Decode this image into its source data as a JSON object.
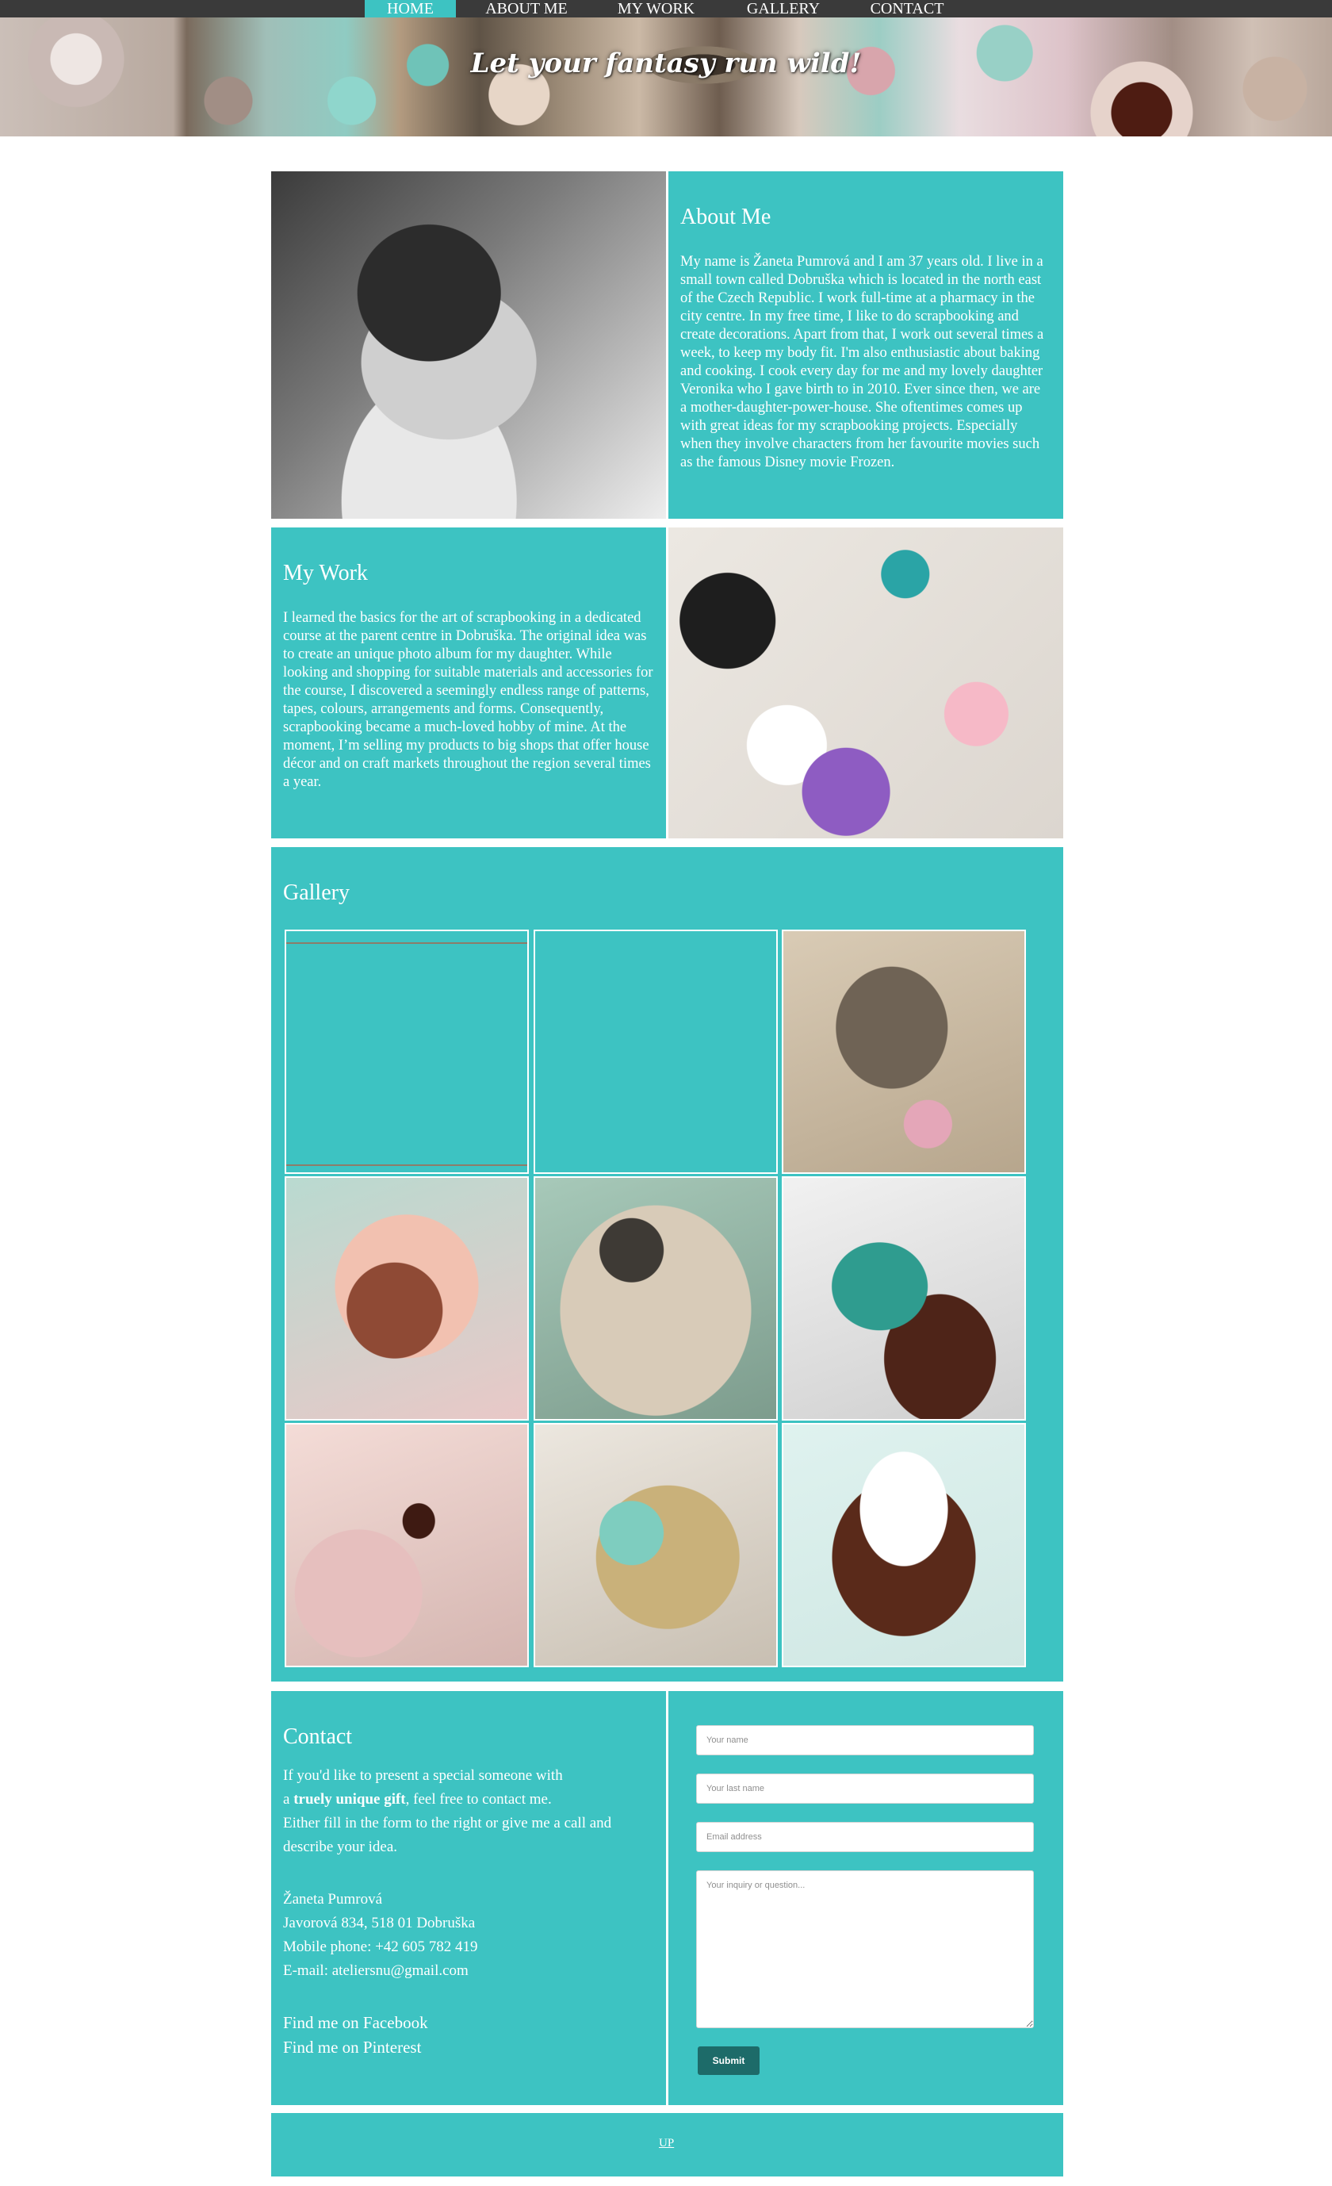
{
  "nav": {
    "items": [
      {
        "label": "HOME",
        "active": true
      },
      {
        "label": "ABOUT ME",
        "active": false
      },
      {
        "label": "MY WORK",
        "active": false
      },
      {
        "label": "GALLERY",
        "active": false
      },
      {
        "label": "CONTACT",
        "active": false
      }
    ]
  },
  "header": {
    "tagline": "Let your fantasy run wild!"
  },
  "about": {
    "title": "About Me",
    "text": "My name is Žaneta Pumrová and I am 37 years old. I live in a small town called Dobruška which is located in the north east of the Czech Republic. I work full-time at a pharmacy in the city centre. In my free time, I like to do scrapbooking and create decorations. Apart from that, I work out several times a week, to keep my body fit. I'm also enthusiastic about baking and cooking. I cook every day for me and my lovely daughter Veronika who I gave birth to in 2010. Ever since then, we are a mother-daughter-power-house. She oftentimes comes up with great ideas for my scrapbooking projects. Especially when they involve characters from her favourite movies such as the famous Disney movie Frozen."
  },
  "work": {
    "title": "My Work",
    "text": "I learned the basics for the art of scrapbooking in a dedicated course at the parent centre in Dobruška. The original idea was to create an unique photo album for my daughter. While looking and shopping for suitable materials and accessories for the course, I discovered a seemingly endless range of patterns, tapes, colours, arrangements and forms. Consequently, scrapbooking became a much-loved hobby of mine. At the moment, I’m selling my products to big shops that offer house décor and on craft markets throughout the region several times a year."
  },
  "gallery": {
    "title": "Gallery"
  },
  "contact": {
    "title": "Contact",
    "intro_1": "If you'd like to present a special someone with",
    "intro_2a": "a ",
    "intro_2b": "truely unique gift",
    "intro_2c": ", feel free to contact me.",
    "intro_3": "Either fill in the form to the right or give me a call and",
    "intro_4": "describe your idea.",
    "name": "Žaneta Pumrová",
    "address": "Javorová 834, 518 01 Dobruška",
    "mobile": "Mobile phone: +42 605 782 419",
    "email": "E-mail: ateliersnu@gmail.com",
    "facebook_prefix": "Find me on ",
    "facebook": "Facebook",
    "pinterest_prefix": "Find me on ",
    "pinterest": "Pinterest",
    "form": {
      "name_placeholder": "Your name",
      "lastname_placeholder": "Your last name",
      "email_placeholder": "Email address",
      "inquiry_placeholder": "Your inquiry or question...",
      "submit_label": "Submit"
    }
  },
  "footer": {
    "up_label": "UP"
  },
  "colors": {
    "accent": "#3dc3c2",
    "nav_bg": "#3a3a3a",
    "button": "#1d6b69"
  }
}
